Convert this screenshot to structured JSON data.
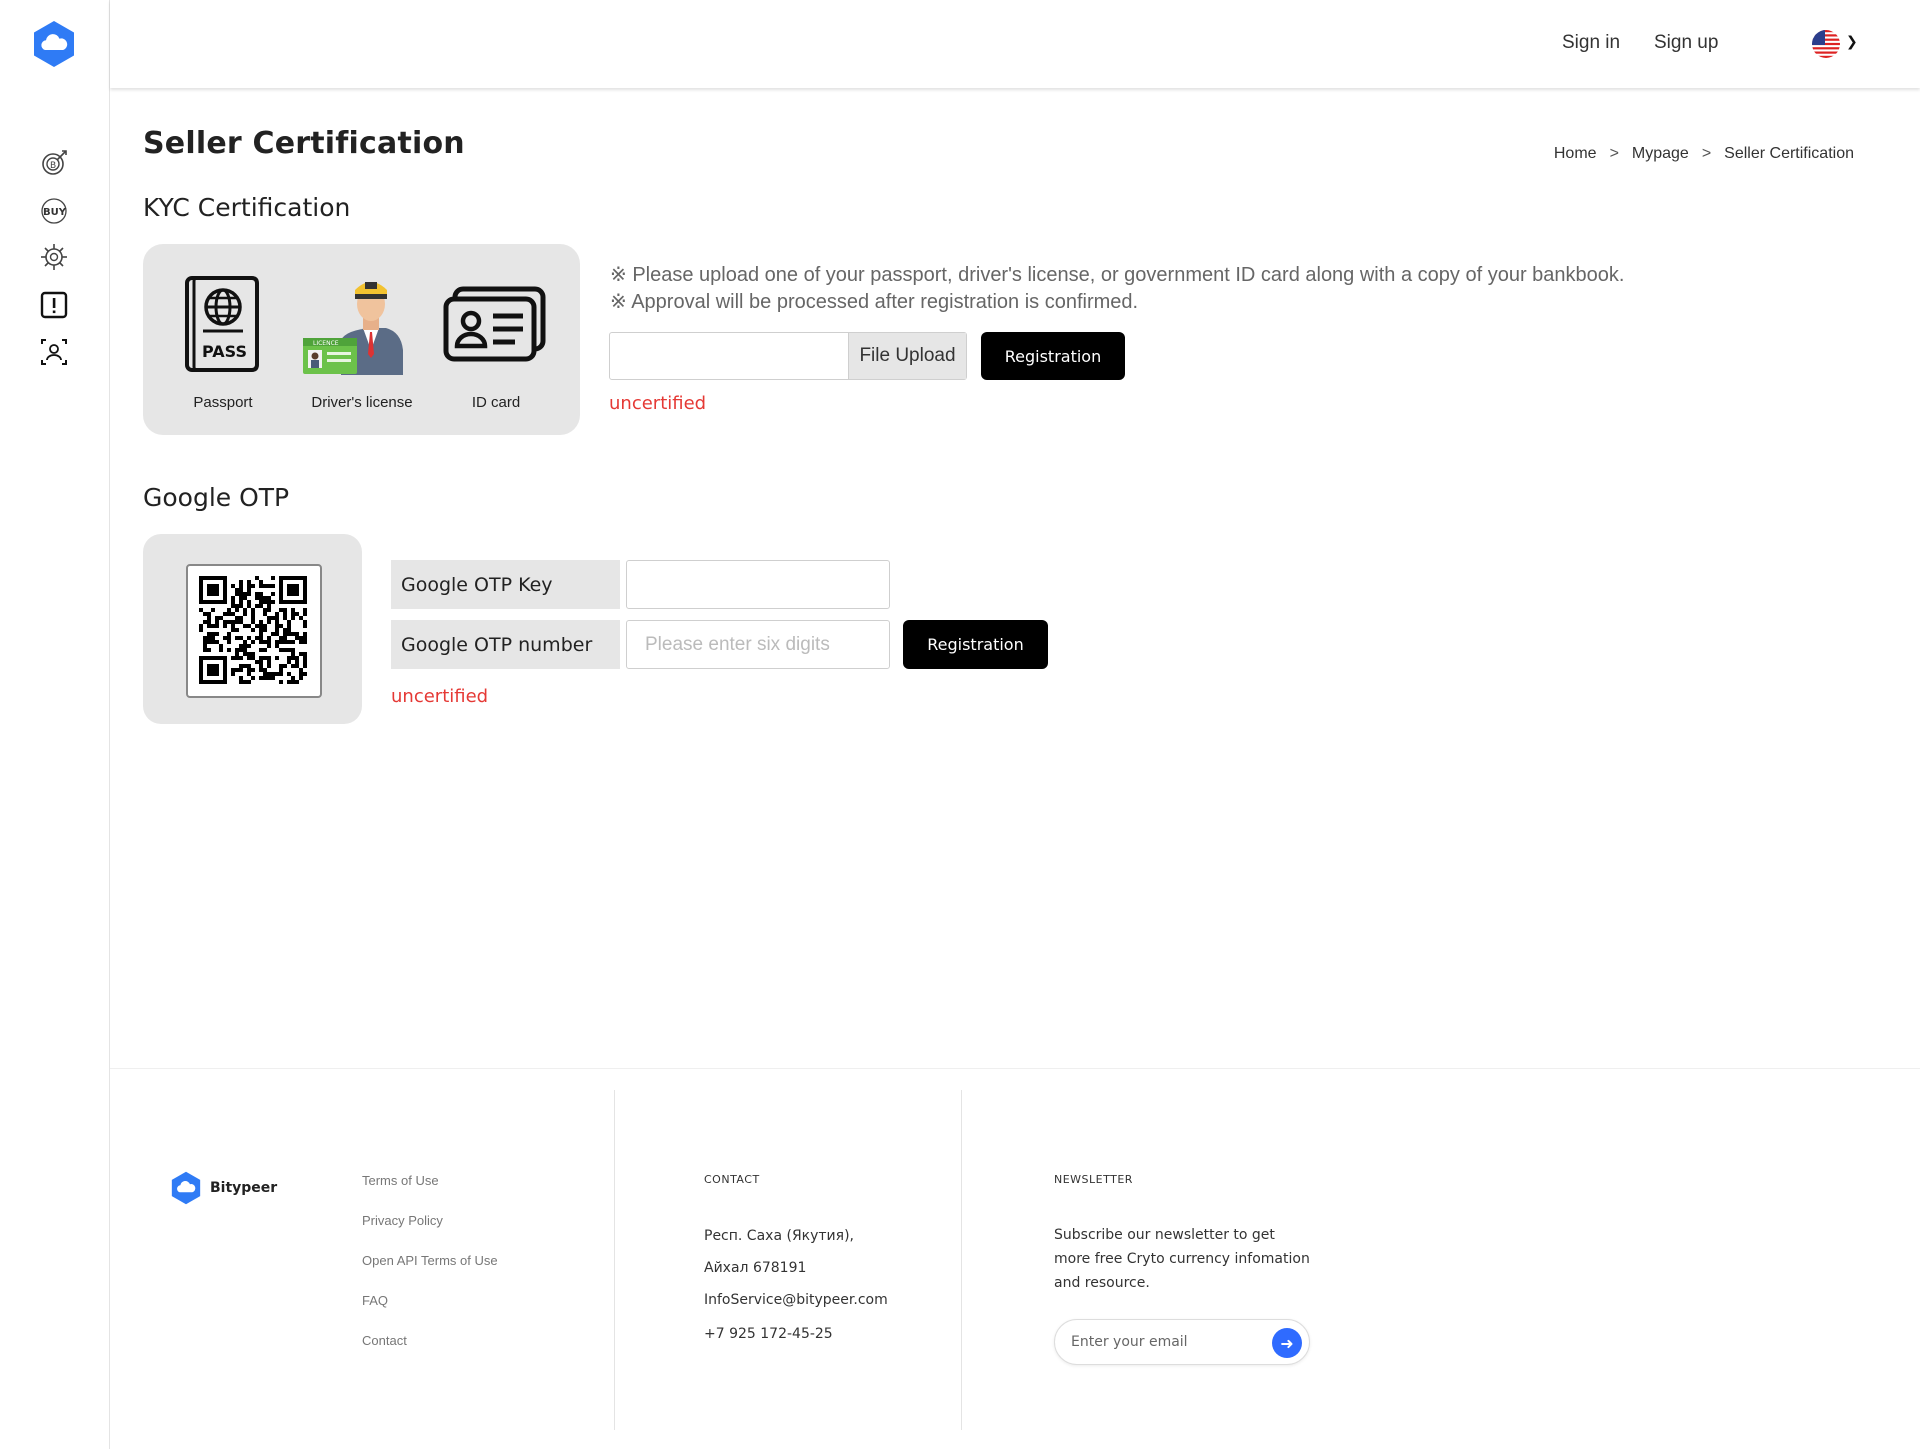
{
  "header": {
    "sign_in": "Sign in",
    "sign_up": "Sign up",
    "language_flag": "us-flag-icon"
  },
  "sidebar": {
    "items": [
      {
        "icon": "bitcoin-target-icon"
      },
      {
        "icon": "buy-icon",
        "label": "BUY"
      },
      {
        "icon": "network-gear-icon"
      },
      {
        "icon": "alert-icon"
      },
      {
        "icon": "user-scan-icon"
      }
    ]
  },
  "page": {
    "title": "Seller Certification",
    "breadcrumb": [
      "Home",
      "Mypage",
      "Seller Certification"
    ],
    "breadcrumb_sep": ">"
  },
  "kyc": {
    "title": "KYC Certification",
    "docs": [
      {
        "label": "Passport"
      },
      {
        "label": "Driver's license"
      },
      {
        "label": "ID card"
      }
    ],
    "pass_text": "PASS",
    "licence_text": "LICENCE",
    "notices": [
      "※ Please upload one of your passport, driver's license, or government ID card along with a copy of your bankbook.",
      "※ Approval will be processed after registration is confirmed."
    ],
    "file_upload_label": "File Upload",
    "register_label": "Registration",
    "status": "uncertified"
  },
  "otp": {
    "title": "Google OTP",
    "key_label": "Google OTP Key",
    "number_label": "Google OTP number",
    "number_placeholder": "Please enter six digits",
    "register_label": "Registration",
    "status": "uncertified"
  },
  "footer": {
    "brand": "Bitypeer",
    "links": [
      "Terms of Use",
      "Privacy Policy",
      "Open API Terms of Use",
      "FAQ",
      "Contact"
    ],
    "contact_heading": "CONTACT",
    "contact_lines": [
      "Респ. Саха (Якутия),",
      "Айхал 678191",
      "InfoService@bitypeer.com",
      "+7 925 172-45-25"
    ],
    "newsletter_heading": "NEWSLETTER",
    "newsletter_lines": [
      "Subscribe our newsletter to get",
      "more free Cryto currency infomation",
      "and resource."
    ],
    "email_placeholder": "Enter your email"
  },
  "colors": {
    "accent_blue": "#2f6bff",
    "status_red": "#e53935",
    "button_black": "#000000",
    "panel_gray": "#e6e6e6"
  }
}
